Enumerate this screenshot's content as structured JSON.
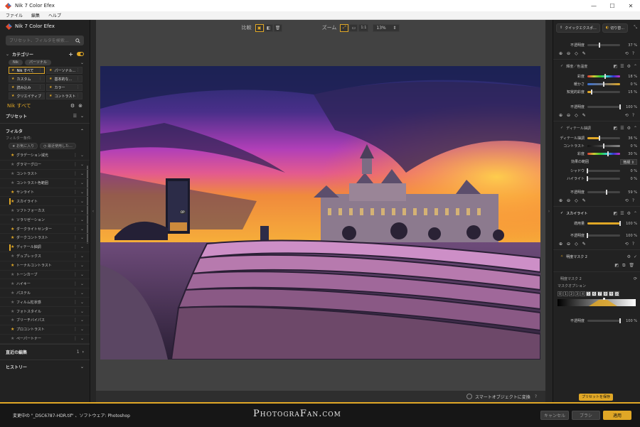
{
  "titlebar": {
    "title": "Nik 7 Color Efex",
    "min": "—",
    "max": "☐",
    "close": "✕"
  },
  "menu": [
    "ファイル",
    "編集",
    "ヘルプ"
  ],
  "left": {
    "app_title": "Nik 7 Color Efex",
    "search_placeholder": "プリセット、フィルタを検索...",
    "category_label": "カテゴリー",
    "tags": [
      "Nik",
      "パーソナル"
    ],
    "categories": [
      {
        "label": "Nik すべて",
        "selected": true
      },
      {
        "label": "パーソナル...",
        "selected": false
      },
      {
        "label": "カスタム",
        "selected": false
      },
      {
        "label": "基本的な...",
        "selected": false
      },
      {
        "label": "読み込み",
        "selected": false
      },
      {
        "label": "カラー",
        "selected": false
      },
      {
        "label": "クリエイティブ",
        "selected": false
      },
      {
        "label": "コントラスト",
        "selected": false
      }
    ],
    "current_category": "Nik すべて",
    "presets_label": "プリセット",
    "filter_label": "フィルタ",
    "filter_conditions": "フィルター条件:",
    "favorites_btn": "★ お気に入り",
    "recent_btn": "◷ 最近使用した...",
    "filters": [
      {
        "label": "グラデーション減光",
        "fav": true,
        "mark": false
      },
      {
        "label": "グラマーグロー",
        "fav": false,
        "mark": false
      },
      {
        "label": "コントラスト",
        "fav": false,
        "mark": false
      },
      {
        "label": "コントラスト色範囲",
        "fav": false,
        "mark": false
      },
      {
        "label": "サンライト",
        "fav": true,
        "mark": false
      },
      {
        "label": "スカイライト",
        "fav": true,
        "mark": true
      },
      {
        "label": "ソフトフォーカス",
        "fav": false,
        "mark": false
      },
      {
        "label": "ソラリゼーション",
        "fav": false,
        "mark": false
      },
      {
        "label": "ダークライトセンター",
        "fav": true,
        "mark": false
      },
      {
        "label": "ダークコントラスト",
        "fav": true,
        "mark": false
      },
      {
        "label": "ディテール抽調",
        "fav": true,
        "mark": true
      },
      {
        "label": "デュプレックス",
        "fav": false,
        "mark": false
      },
      {
        "label": "トーナルコントラスト",
        "fav": true,
        "mark": false
      },
      {
        "label": "トーンカーブ",
        "fav": false,
        "mark": false
      },
      {
        "label": "ハイキー",
        "fav": false,
        "mark": false
      },
      {
        "label": "パステル",
        "fav": false,
        "mark": false
      },
      {
        "label": "フィルム粒状感",
        "fav": false,
        "mark": false
      },
      {
        "label": "フォトスタイル",
        "fav": false,
        "mark": false
      },
      {
        "label": "ブリーチバイパス",
        "fav": false,
        "mark": false
      },
      {
        "label": "プロコントラスト",
        "fav": true,
        "mark": false
      },
      {
        "label": "ペーパートナー",
        "fav": false,
        "mark": false
      }
    ],
    "recent_edits": "直近の編集",
    "recent_count": "1",
    "history": "ヒストリー"
  },
  "center": {
    "compare_label": "比較",
    "zoom_label": "ズーム",
    "zoom_one": "1:1",
    "zoom_value": "13%",
    "photo_label": "OP",
    "smart_label": "スマートオブジェクトに変換"
  },
  "right": {
    "quick_export": "クイックエクスポ...",
    "crop": "切り替...",
    "top_slider": {
      "label": "不透明度",
      "value": "37 %",
      "pct": 0.37
    },
    "section1": {
      "title": "輝度／色温度",
      "sliders": [
        {
          "label": "彩度",
          "value": "18 %",
          "pct": 0.55,
          "type": "hue"
        },
        {
          "label": "暖かさ",
          "value": "0 %",
          "pct": 0.5,
          "type": "warm"
        },
        {
          "label": "知覚的彩度",
          "value": "15 %",
          "pct": 0.12,
          "type": "fill"
        }
      ],
      "opacity": {
        "label": "不透明度",
        "value": "100 %",
        "pct": 1.0
      }
    },
    "section2": {
      "title": "ディテール抽調",
      "sliders": [
        {
          "label": "ディテール抽調",
          "value": "36 %",
          "pct": 0.36,
          "type": "fill"
        },
        {
          "label": "コントラスト",
          "value": "0 %",
          "pct": 0.5,
          "type": "dark"
        },
        {
          "label": "彩度",
          "value": "30 %",
          "pct": 0.62,
          "type": "hue"
        }
      ],
      "range_label": "効果の範囲",
      "range_value": "微細",
      "more": [
        {
          "label": "シャドウ",
          "value": "0 %",
          "pct": 0.0,
          "type": "fill"
        },
        {
          "label": "ハイライト",
          "value": "0 %",
          "pct": 0.0,
          "type": "fill"
        }
      ],
      "opacity": {
        "label": "不透明度",
        "value": "59 %",
        "pct": 0.59
      }
    },
    "section3": {
      "title": "スカイライト",
      "sliders": [
        {
          "label": "適用量",
          "value": "100 %",
          "pct": 1.0,
          "type": "fill"
        }
      ],
      "opacity": {
        "label": "不透明度",
        "value": "100 %",
        "pct": 0.0
      }
    },
    "mask_item": "明度マスク 2",
    "mask_title": "明度マスク 2",
    "mask_options": "マスクオプション",
    "mask_numbers": [
      "0",
      "1",
      "2",
      "3",
      "4",
      "5",
      "6",
      "7",
      "8",
      "9",
      "10"
    ],
    "mask_opacity": {
      "label": "不透明度",
      "value": "100 %",
      "pct": 1.0
    },
    "save_preset": "プリセットを保存"
  },
  "bottom": {
    "status": "変更中の \"_DSC6787-HDR.tif\" 、ソフトウェア: Photoshop",
    "watermark": "PhotograFan.com",
    "cancel": "キャンセル",
    "brush": "ブラシ",
    "apply": "適用"
  },
  "colors": {
    "accent": "#e0a726",
    "panel": "#222222",
    "canvas": "#424242"
  }
}
